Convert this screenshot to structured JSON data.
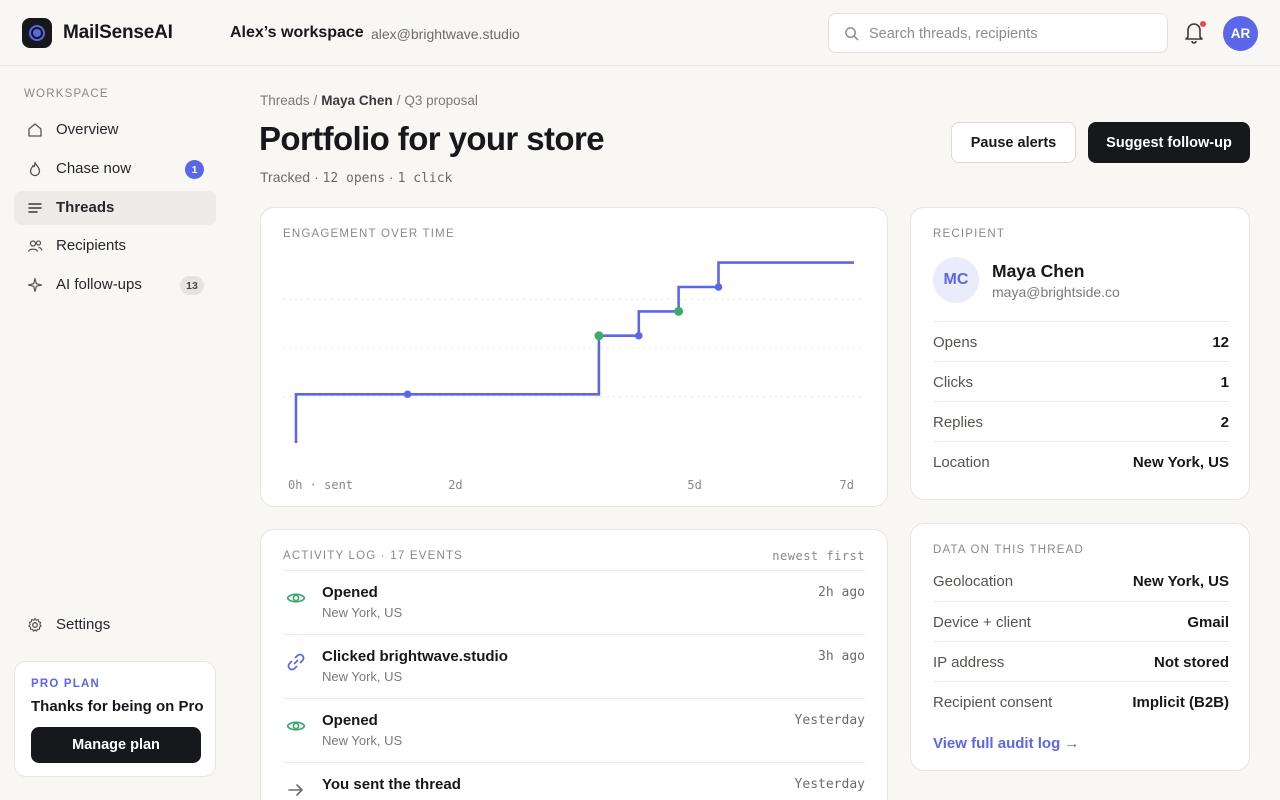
{
  "app": {
    "name": "MailSenseAI"
  },
  "header": {
    "workspace_name": "Alex’s workspace",
    "workspace_email": "alex@brightwave.studio",
    "search_placeholder": "Search threads, recipients",
    "avatar_initials": "AR"
  },
  "sidebar": {
    "section_label": "WORKSPACE",
    "items": [
      {
        "label": "Overview",
        "icon": "home-icon"
      },
      {
        "label": "Chase now",
        "icon": "flame-icon",
        "badge": "1"
      },
      {
        "label": "Threads",
        "icon": "threads-icon",
        "active": true
      },
      {
        "label": "Recipients",
        "icon": "users-icon"
      },
      {
        "label": "AI follow-ups",
        "icon": "sparkle-icon",
        "badge": "13"
      }
    ],
    "settings_label": "Settings",
    "plan": {
      "kicker": "PRO PLAN",
      "title": "Thanks for being on Pro",
      "button": "Manage plan"
    }
  },
  "breadcrumb": {
    "root": "Threads",
    "middle": "Maya Chen",
    "current": "Q3 proposal",
    "separator": "/"
  },
  "page": {
    "title": "Portfolio for your store",
    "tracked_label": "Tracked",
    "tracked_opens": "12 opens",
    "tracked_clicks": "1 click",
    "pause_button": "Pause alerts",
    "suggest_button": "Suggest follow-up"
  },
  "chart_data": {
    "type": "line",
    "title": "ENGAGEMENT OVER TIME",
    "step": true,
    "x_tick_labels": [
      "0h · sent",
      "2d",
      "5d",
      "7d"
    ],
    "x_ticks": [
      0,
      2,
      5,
      7
    ],
    "xlim": [
      0,
      7
    ],
    "ylim": [
      0,
      4
    ],
    "grid": true,
    "series": [
      {
        "color": "#5b67e8",
        "points": [
          [
            0,
            0
          ],
          [
            0,
            1
          ],
          [
            1.4,
            1
          ],
          [
            3.8,
            1
          ],
          [
            3.8,
            2.2
          ],
          [
            4.3,
            2.2
          ],
          [
            4.3,
            2.7
          ],
          [
            4.8,
            2.7
          ],
          [
            4.8,
            3.2
          ],
          [
            5.3,
            3.2
          ],
          [
            5.3,
            3.7
          ],
          [
            7,
            3.7
          ]
        ]
      }
    ],
    "markers": [
      {
        "x": 1.4,
        "y": 1,
        "kind": "open"
      },
      {
        "x": 3.8,
        "y": 2.2,
        "kind": "click"
      },
      {
        "x": 4.3,
        "y": 2.2,
        "kind": "open"
      },
      {
        "x": 4.8,
        "y": 2.7,
        "kind": "click"
      },
      {
        "x": 5.3,
        "y": 3.2,
        "kind": "open"
      }
    ],
    "colors": {
      "open": "#5b67e8",
      "click": "#3dab6e"
    }
  },
  "recipient": {
    "kicker": "RECIPIENT",
    "initials": "MC",
    "name": "Maya Chen",
    "email": "maya@brightside.co",
    "stats": [
      {
        "label": "Opens",
        "value": "12"
      },
      {
        "label": "Clicks",
        "value": "1"
      },
      {
        "label": "Replies",
        "value": "2"
      },
      {
        "label": "Location",
        "value": "New York, US"
      }
    ]
  },
  "thread_data": {
    "kicker": "DATA ON THIS THREAD",
    "rows": [
      {
        "label": "Geolocation",
        "value": "New York, US"
      },
      {
        "label": "Device + client",
        "value": "Gmail"
      },
      {
        "label": "IP address",
        "value": "Not stored"
      },
      {
        "label": "Recipient consent",
        "value": "Implicit (B2B)"
      }
    ],
    "audit_link": "View full audit log →"
  },
  "activity": {
    "kicker": "ACTIVITY LOG · 17 EVENTS",
    "sort_label": "newest first",
    "events": [
      {
        "title": "Opened",
        "subtitle": "New York, US",
        "time": "2h ago",
        "icon": "eye-icon"
      },
      {
        "title": "Clicked brightwave.studio",
        "subtitle": "New York, US",
        "time": "3h ago",
        "icon": "link-icon"
      },
      {
        "title": "Opened",
        "subtitle": "New York, US",
        "time": "Yesterday",
        "icon": "eye-icon"
      },
      {
        "title": "You sent the thread",
        "subtitle": "",
        "time": "Yesterday",
        "icon": "arrow-right-icon"
      }
    ]
  },
  "colors": {
    "accent": "#5b67e8",
    "success": "#3dab6e",
    "dark": "#17181c",
    "alert": "#e5484d"
  }
}
